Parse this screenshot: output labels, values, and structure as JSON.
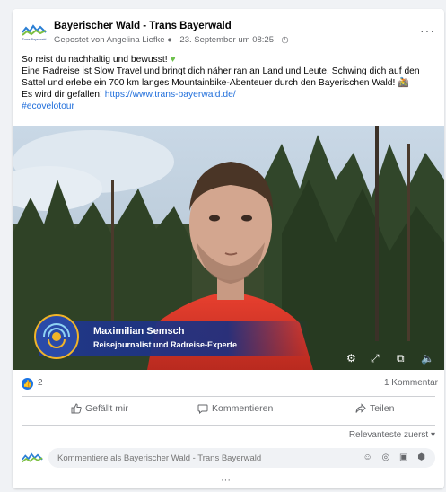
{
  "post": {
    "page_name": "Bayerischer Wald - Trans Bayerwald",
    "meta": "Gepostet von Angelina Liefke ● · 23. September um 08:25 · ◷",
    "more_label": "···",
    "logo_caption": "Trans Bayerwald",
    "text_line1": "So reist du nachhaltig und bewusst! ",
    "heart": "♥",
    "text_line2": "Eine Radreise ist Slow Travel und bringt dich näher ran an Land und Leute. Schwing dich auf den Sattel und erlebe ein 700 km langes Mountainbike-Abenteuer durch den Bayerischen Wald! 🚵",
    "text_line3_prefix": "Es wird dir gefallen! ",
    "link": "https://www.trans-bayerwald.de/",
    "hashtag": "#ecovelotour"
  },
  "video": {
    "lower_third_name": "Maximilian Semsch",
    "lower_third_role": "Reisejournalist und Radreise-Experte",
    "controls": {
      "settings": "⚙",
      "fullscreen": "⤢",
      "pip": "⧉",
      "volume": "🔈"
    }
  },
  "stats": {
    "like_icon": "👍",
    "like_count": "2",
    "comment_count": "1 Kommentar"
  },
  "actions": {
    "like": "Gefällt mir",
    "comment": "Kommentieren",
    "share": "Teilen"
  },
  "comments": {
    "sort_label": "Relevanteste zuerst ▾",
    "placeholder": "Kommentiere als Bayerischer Wald - Trans Bayerwald",
    "composer_icons": "☺ ◎ ▣ ⬢",
    "more": "···"
  },
  "colors": {
    "accent": "#1b74e4",
    "link": "#216fdb",
    "heart": "#6cc04a",
    "lower_third": "#20388c",
    "badge_ring": "#f0b429"
  }
}
